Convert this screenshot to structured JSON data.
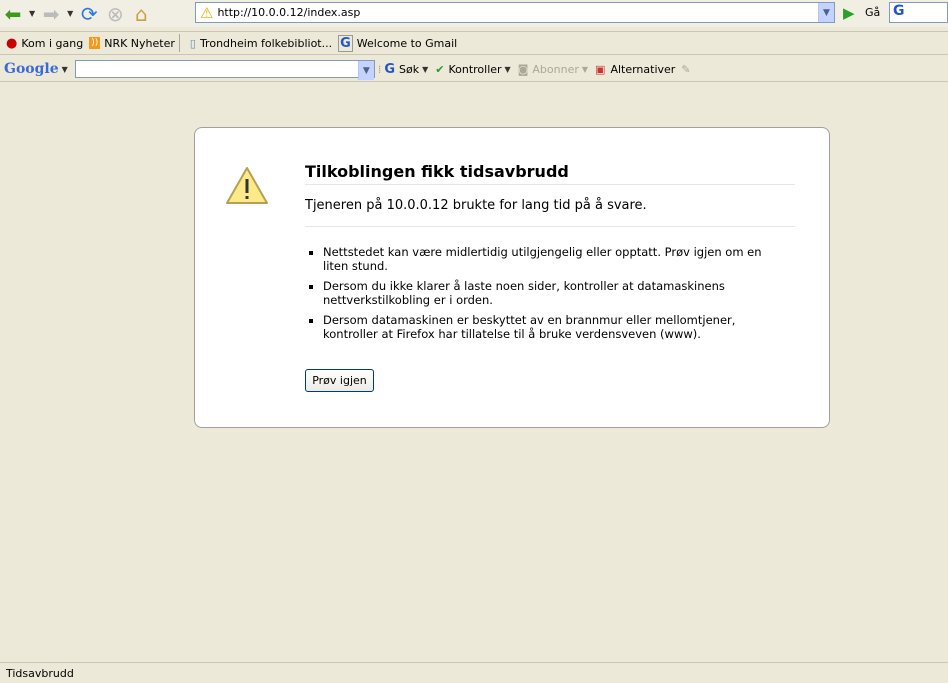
{
  "nav": {
    "url": "http://10.0.0.12/index.asp",
    "go_label": "Gå"
  },
  "bookmarks": [
    {
      "label": "Kom i gang"
    },
    {
      "label": "NRK Nyheter"
    },
    {
      "label": "Trondheim folkebibliot..."
    },
    {
      "label": "Welcome to Gmail"
    }
  ],
  "google_toolbar": {
    "logo": "Google",
    "search_value": "",
    "search_label": "Søk",
    "check_label": "Kontroller",
    "subscribe_label": "Abonner",
    "options_label": "Alternativer"
  },
  "error": {
    "title": "Tilkoblingen fikk tidsavbrudd",
    "subtitle": "Tjeneren på 10.0.0.12 brukte for lang tid på å svare.",
    "items": [
      "Nettstedet kan være midlertidig utilgjengelig eller opptatt. Prøv igjen om en liten stund.",
      "Dersom du ikke klarer å laste noen sider, kontroller at datamaskinens nettverkstilkobling er i orden.",
      "Dersom datamaskinen er beskyttet av en brannmur eller mellomtjener, kontroller at Firefox har tillatelse til å bruke verdensveven (www)."
    ],
    "retry_label": "Prøv igjen"
  },
  "status": "Tidsavbrudd"
}
